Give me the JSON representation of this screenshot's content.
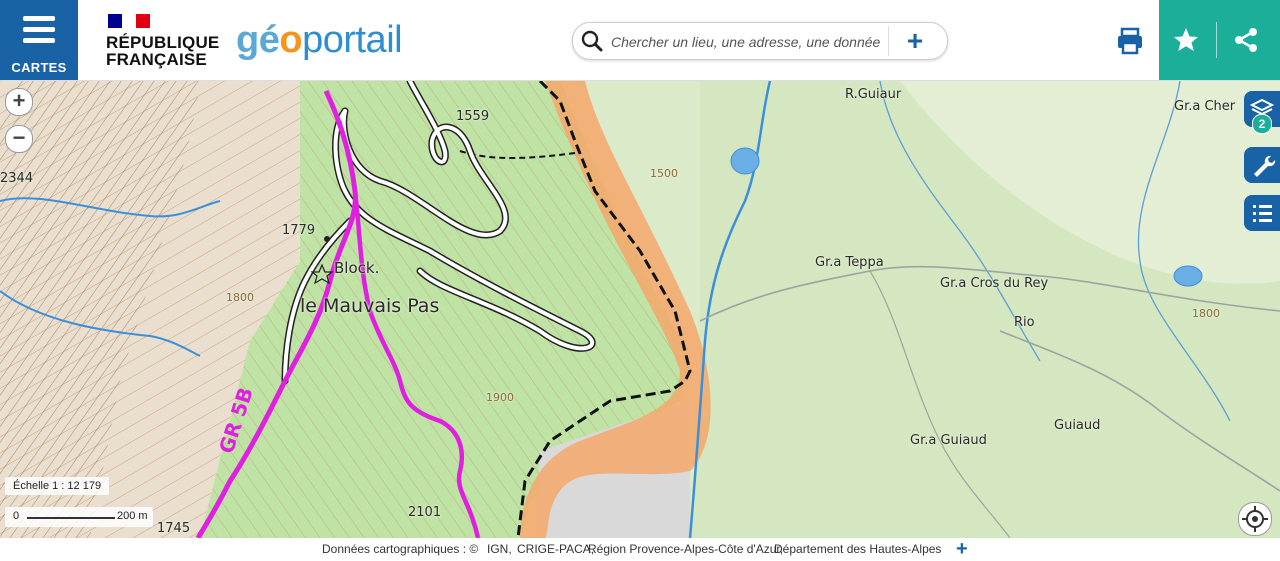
{
  "header": {
    "menu_label": "CARTES",
    "rf_line1": "RÉPUBLIQUE",
    "rf_line2": "FRANÇAISE",
    "brand_geo_g": "g",
    "brand_geo_e": "é",
    "brand_geo_o": "o",
    "brand_portail": "portail",
    "search_placeholder": "Chercher un lieu, une adresse, une donnée",
    "search_plus": "+"
  },
  "map": {
    "labels": {
      "peak_1559": "1559",
      "peak_1779": "1779",
      "peak_2344": "2344",
      "block": "Block.",
      "mauvais_pas": "le Mauvais Pas",
      "gr5b": "GR 5B",
      "peak_2101": "2101",
      "peak_1745": "1745",
      "r_guiaur": "R.Guiaur",
      "gr_a_cher": "Gr.a Cher",
      "gr_a_teppa": "Gr.a Teppa",
      "gr_a_cros": "Gr.a Cros du Rey",
      "rio": "Rio",
      "gr_a_guiaud": "Gr.a Guiaud",
      "guiaud": "Guiaud",
      "contour_1500": "1500",
      "contour_1800a": "1800",
      "contour_1800b": "1800",
      "contour_1900": "1900"
    },
    "layers_count": "2",
    "zoom_in": "+",
    "zoom_out": "−",
    "scale_label": "Échelle 1 : 12 179",
    "scale_start": "0",
    "scale_end": "200 m"
  },
  "footer": {
    "prefix": "Données cartographiques : ©",
    "sources": [
      "IGN,",
      "CRIGE-PACA,",
      "Région Provence-Alpes-Côte d'Azur,",
      "Département des Hautes-Alpes"
    ],
    "plus": "+"
  },
  "colors": {
    "header_blue": "#1862a5",
    "teal": "#1bae99",
    "route_magenta": "#e020e0",
    "border_orange": "#f4a76a"
  }
}
